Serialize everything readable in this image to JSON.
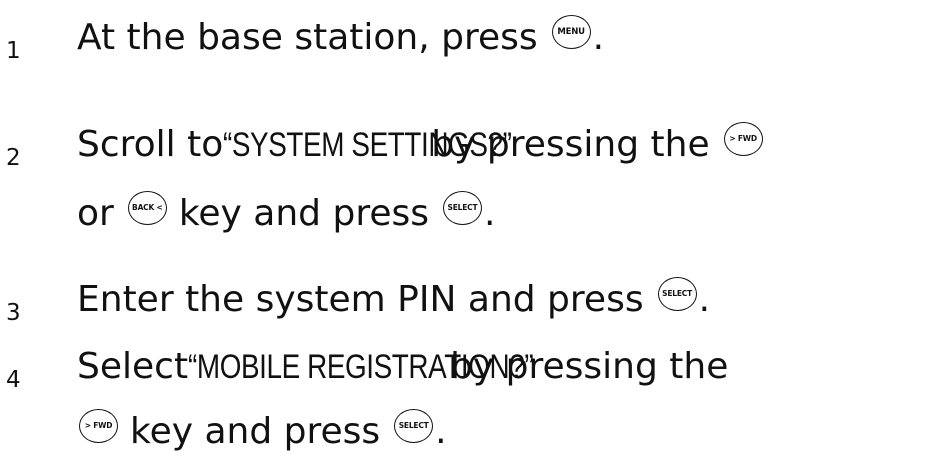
{
  "steps": [
    {
      "number": "1",
      "line1": {
        "text_a": "At the base station, press",
        "key_a": "MENU",
        "text_b": "."
      }
    },
    {
      "number": "2",
      "line1": {
        "text_a": "Scroll to ",
        "setting": "“SYSTEM SETTINGS?”",
        "text_b": " by pressing the",
        "key_a": "> FWD"
      },
      "line2": {
        "text_a": "or",
        "key_a": "BACK <",
        "text_b": "key and press",
        "key_b": "SELECT",
        "text_c": "."
      }
    },
    {
      "number": "3",
      "line1": {
        "text_a": "Enter the system PIN and press",
        "key_a": "SELECT",
        "text_b": "."
      }
    },
    {
      "number": "4",
      "line1": {
        "text_a": "Select ",
        "setting": "“MOBILE REGISTRATION?”",
        "text_b": " by pressing the"
      },
      "line2": {
        "key_a": "> FWD",
        "text_a": "key and press",
        "key_b": "SELECT",
        "text_b": "."
      }
    }
  ]
}
